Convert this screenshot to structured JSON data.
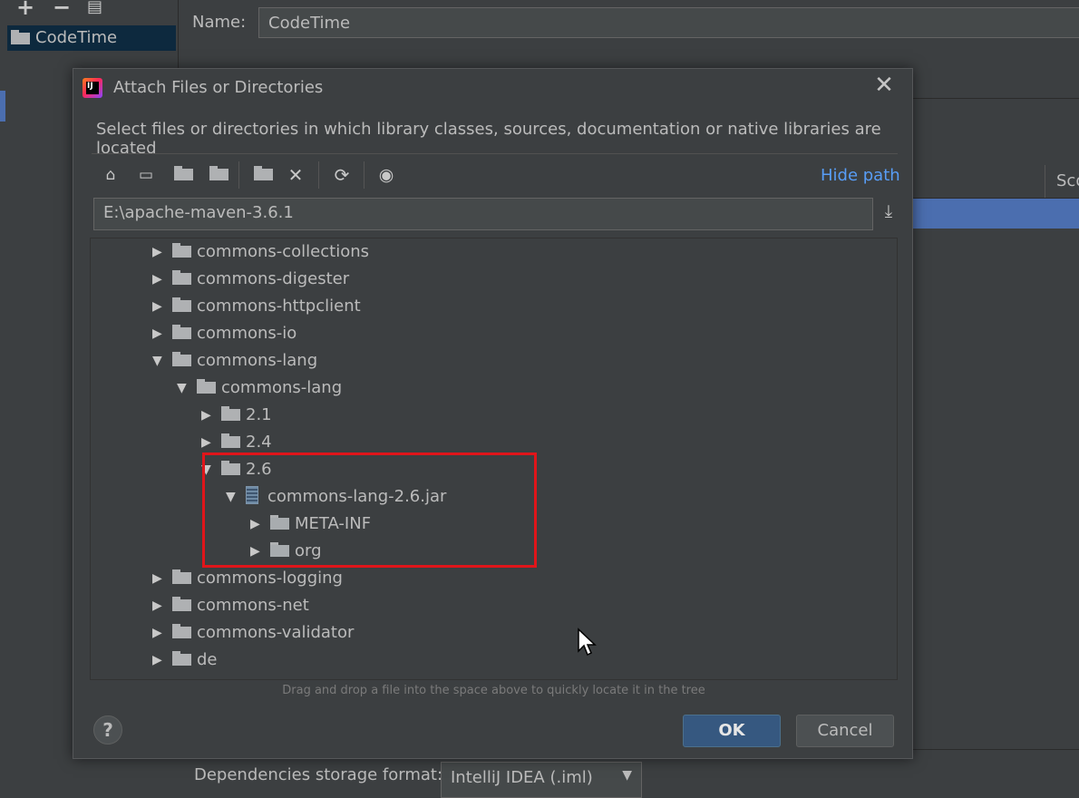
{
  "background": {
    "project_item": "CodeTime",
    "name_label": "Name:",
    "name_value": "CodeTime",
    "table_header_partial": "Sco",
    "deps_label": "Dependencies storage format:",
    "deps_value": "IntelliJ IDEA (.iml)"
  },
  "dialog": {
    "title": "Attach Files or Directories",
    "description": "Select files or directories in which library classes, sources, documentation or native libraries are located",
    "hide_path": "Hide path",
    "path_value": "E:\\apache-maven-3.6.1",
    "hint": "Drag and drop a file into the space above to quickly locate it in the tree",
    "ok": "OK",
    "cancel": "Cancel",
    "help": "?"
  },
  "tree": {
    "rows": [
      {
        "label": "commons-collections",
        "expanded": false
      },
      {
        "label": "commons-digester",
        "expanded": false
      },
      {
        "label": "commons-httpclient",
        "expanded": false
      },
      {
        "label": "commons-io",
        "expanded": false
      },
      {
        "label": "commons-lang",
        "expanded": true
      },
      {
        "label": "commons-lang",
        "expanded": true
      },
      {
        "label": "2.1",
        "expanded": false
      },
      {
        "label": "2.4",
        "expanded": false
      },
      {
        "label": "2.6",
        "expanded": true
      },
      {
        "label": "commons-lang-2.6.jar",
        "expanded": true
      },
      {
        "label": "META-INF",
        "expanded": false
      },
      {
        "label": "org",
        "expanded": false
      },
      {
        "label": "commons-logging",
        "expanded": false
      },
      {
        "label": "commons-net",
        "expanded": false
      },
      {
        "label": "commons-validator",
        "expanded": false
      },
      {
        "label": "de",
        "expanded": false
      }
    ]
  },
  "colors": {
    "background": "#3c3f41",
    "selection": "#4b6eaf",
    "link": "#589df6",
    "highlight_box": "#e0151a",
    "ok_button": "#365880"
  },
  "icons": [
    "add-icon",
    "remove-icon",
    "copy-icon",
    "home-icon",
    "desktop-icon",
    "project-folder-icon",
    "module-folder-icon",
    "new-folder-icon",
    "delete-icon",
    "refresh-icon",
    "show-hidden-icon",
    "download-icon",
    "close-icon",
    "folder-icon",
    "jar-icon",
    "help-icon"
  ]
}
